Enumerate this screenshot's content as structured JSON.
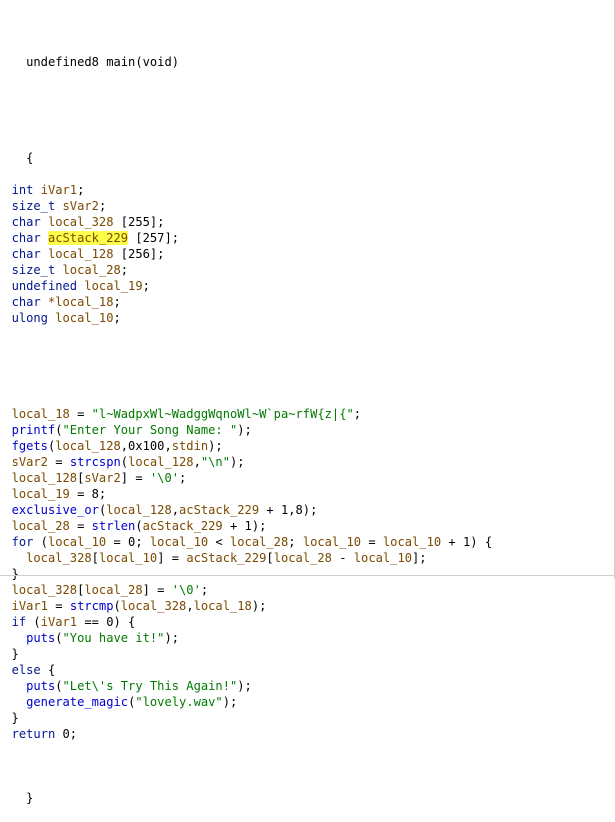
{
  "code": {
    "signature": "undefined8 main(void)",
    "open_brace": "{",
    "decls": [
      {
        "type": "int",
        "name": "iVar1",
        "suffix": ";"
      },
      {
        "type": "size_t",
        "name": "sVar2",
        "suffix": ";"
      },
      {
        "type": "char",
        "name": "local_328",
        "suffix": " [255];"
      },
      {
        "type": "char",
        "name": "acStack_229",
        "suffix": " [257];"
      },
      {
        "type": "char",
        "name": "local_128",
        "suffix": " [256];"
      },
      {
        "type": "size_t",
        "name": "local_28",
        "suffix": ";"
      },
      {
        "type": "undefined",
        "name": "local_19",
        "suffix": ";"
      },
      {
        "type": "char",
        "name": "*local_18",
        "suffix": ";"
      },
      {
        "type": "ulong",
        "name": "local_10",
        "suffix": ";"
      }
    ],
    "statements": [
      "local_18 = \"l~WadpxWl~WadggWqnoWl~W`pa~rfW{z|{\";",
      "printf(\"Enter Your Song Name: \");",
      "fgets(local_128,0x100,stdin);",
      "sVar2 = strcspn(local_128,\"\\n\");",
      "local_128[sVar2] = '\\0';",
      "local_19 = 8;",
      "exclusive_or(local_128,acStack_229 + 1,8);",
      "local_28 = strlen(acStack_229 + 1);",
      "for (local_10 = 0; local_10 < local_28; local_10 = local_10 + 1) {",
      "  local_328[local_10] = acStack_229[local_28 - local_10];",
      "}",
      "local_328[local_28] = '\\0';",
      "iVar1 = strcmp(local_328,local_18);",
      "if (iVar1 == 0) {",
      "  puts(\"You have it!\");",
      "}",
      "else {",
      "  puts(\"Let\\'s Try This Again!\");",
      "  generate_magic(\"lovely.wav\");",
      "}",
      "return 0;"
    ],
    "close_brace": "}",
    "highlighted_token": "acStack_229",
    "cursor_line": 4
  },
  "colors": {
    "keyword": "#00188f",
    "variable": "#7a4a00",
    "function": "#0000d0",
    "string": "#007a00",
    "highlight": "#ffff4a"
  }
}
